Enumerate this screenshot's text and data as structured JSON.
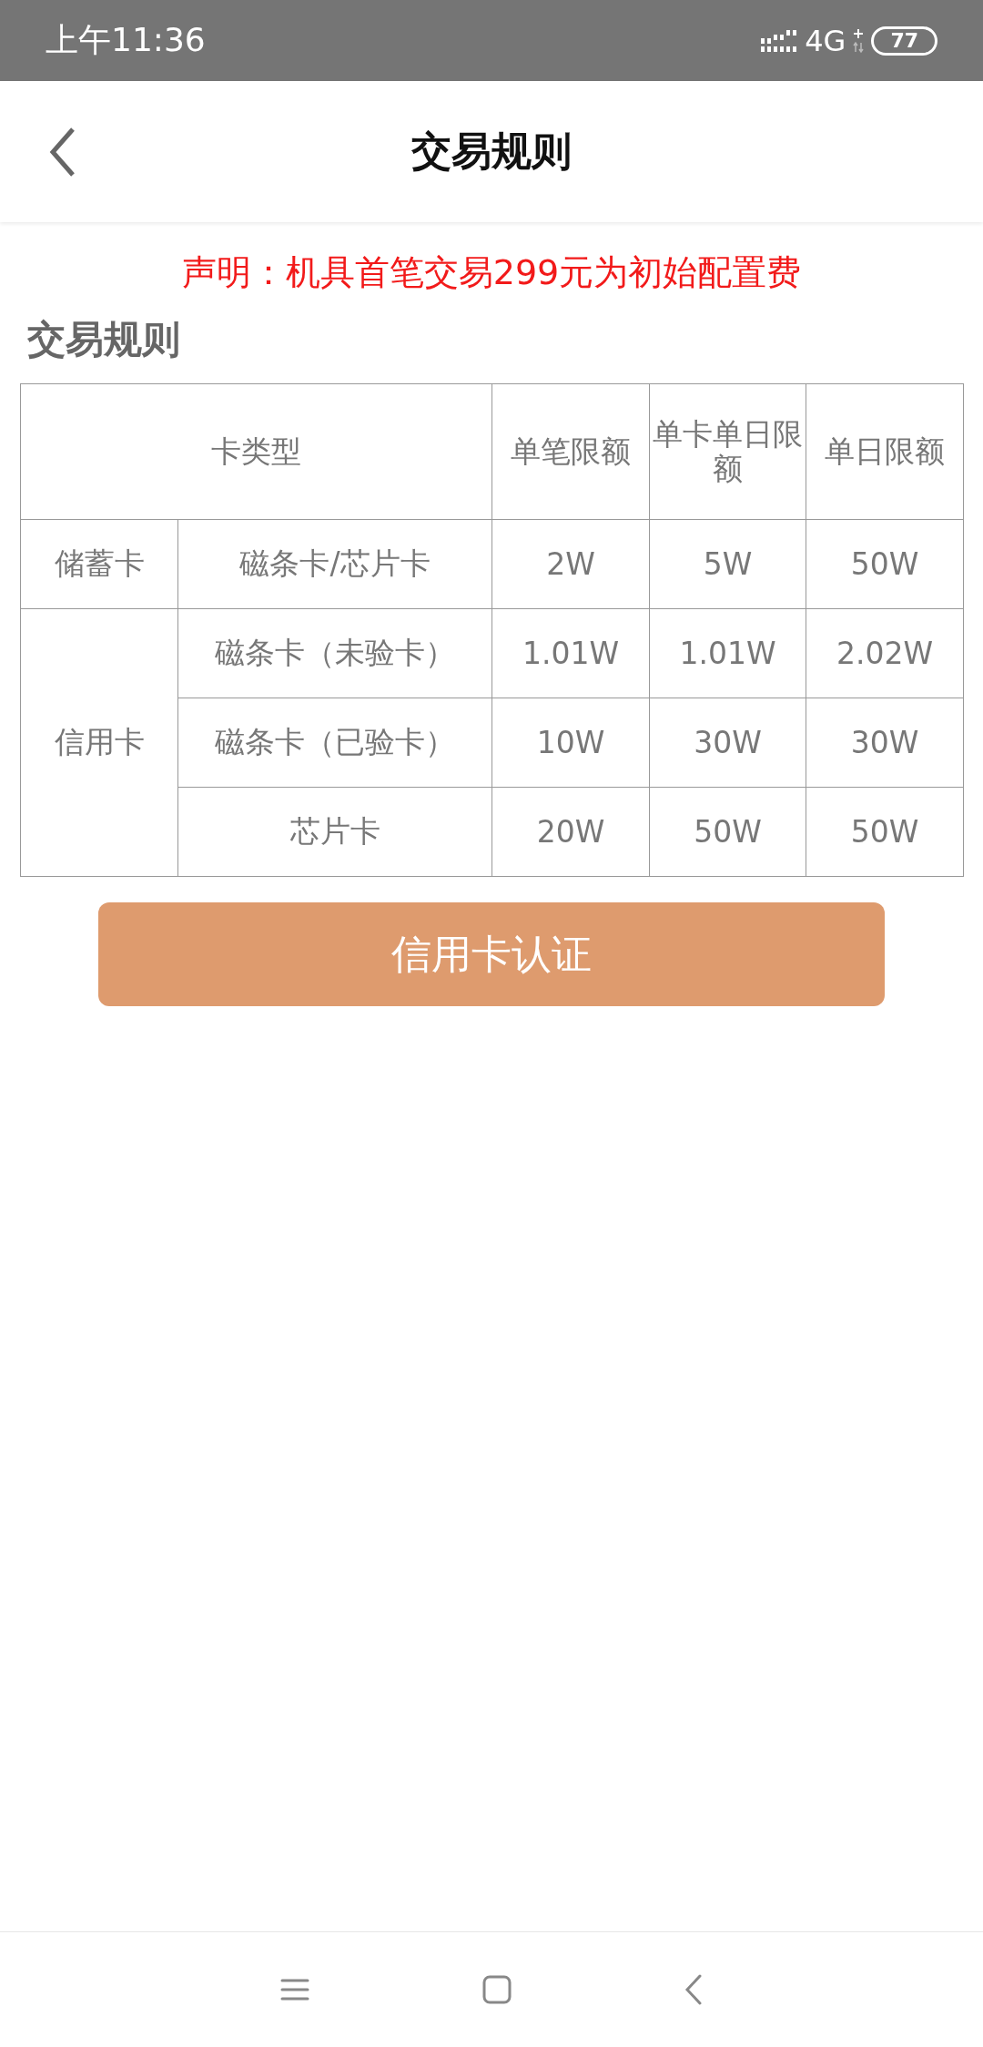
{
  "status_bar": {
    "time": "上午11:36",
    "network": "4G",
    "battery": "77"
  },
  "header": {
    "title": "交易规则"
  },
  "notice": "声明：机具首笔交易299元为初始配置费",
  "section_title": "交易规则",
  "table": {
    "columns": [
      "卡类型",
      "单笔限额",
      "单卡单日限额",
      "单日限额"
    ],
    "groups": [
      {
        "category": "储蓄卡",
        "rows": [
          {
            "type": "磁条卡/芯片卡",
            "values": [
              "2W",
              "5W",
              "50W"
            ]
          }
        ]
      },
      {
        "category": "信用卡",
        "rows": [
          {
            "type": "磁条卡（未验卡）",
            "values": [
              "1.01W",
              "1.01W",
              "2.02W"
            ]
          },
          {
            "type": "磁条卡（已验卡）",
            "values": [
              "10W",
              "30W",
              "30W"
            ]
          },
          {
            "type": "芯片卡",
            "values": [
              "20W",
              "50W",
              "50W"
            ]
          }
        ]
      }
    ]
  },
  "button": "信用卡认证"
}
